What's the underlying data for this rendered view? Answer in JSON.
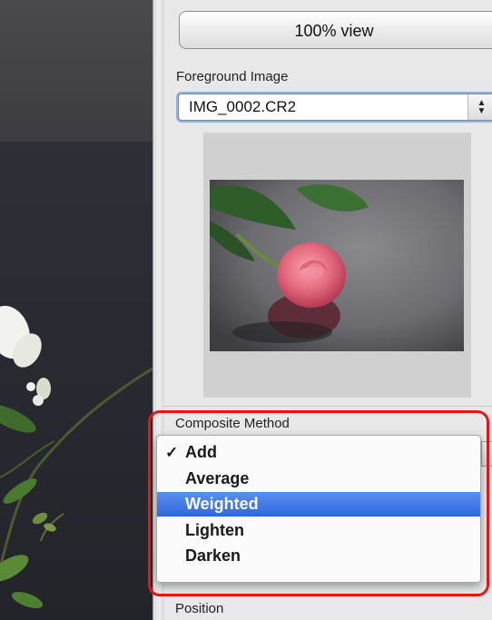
{
  "panel": {
    "view_button_label": "100% view",
    "foreground_label": "Foreground Image",
    "foreground_select_value": "IMG_0002.CR2",
    "composite_method_label": "Composite Method",
    "position_label": "Position"
  },
  "composite_menu": {
    "items": [
      {
        "label": "Add",
        "checked": true
      },
      {
        "label": "Average",
        "checked": false
      },
      {
        "label": "Weighted",
        "checked": false,
        "highlighted": true
      },
      {
        "label": "Lighten",
        "checked": false
      },
      {
        "label": "Darken",
        "checked": false
      }
    ],
    "check_glyph": "✓"
  },
  "colors": {
    "highlight_border": "#e8141b",
    "menu_selection": "#3a72e6",
    "select_focus_ring": "#8ab4e8"
  },
  "icons": {
    "select_arrows": "up-down-arrows-icon",
    "check": "checkmark-icon"
  }
}
